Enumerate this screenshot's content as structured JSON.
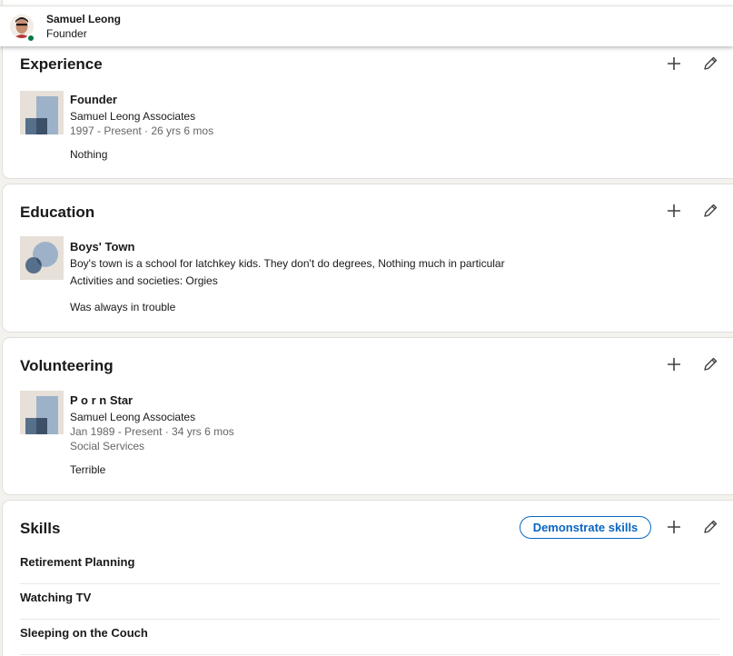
{
  "header": {
    "name": "Samuel Leong",
    "title": "Founder"
  },
  "experience": {
    "title": "Experience",
    "item": {
      "role": "Founder",
      "company": "Samuel Leong Associates",
      "dates": "1997 - Present · 26 yrs 6 mos",
      "description": "Nothing"
    }
  },
  "education": {
    "title": "Education",
    "item": {
      "school": "Boys' Town",
      "summary": "Boy's town is a school for latchkey kids. They don't do degrees, Nothing much in particular",
      "activities": "Activities and societies: Orgies",
      "description": "Was always in trouble"
    }
  },
  "volunteering": {
    "title": "Volunteering",
    "item": {
      "role": "P o r n Star",
      "organization": "Samuel Leong Associates",
      "dates": "Jan 1989 - Present · 34 yrs 6 mos",
      "cause": "Social Services",
      "description": "Terrible"
    }
  },
  "skills": {
    "title": "Skills",
    "demonstrate_label": "Demonstrate skills",
    "items": [
      "Retirement Planning",
      "Watching TV",
      "Sleeping on the Couch"
    ]
  },
  "icons": {
    "add": "plus-icon",
    "edit": "pencil-icon"
  },
  "colors": {
    "brand_blue": "#0a66c2",
    "presence_green": "#057642",
    "page_bg": "#f4f2ee"
  }
}
